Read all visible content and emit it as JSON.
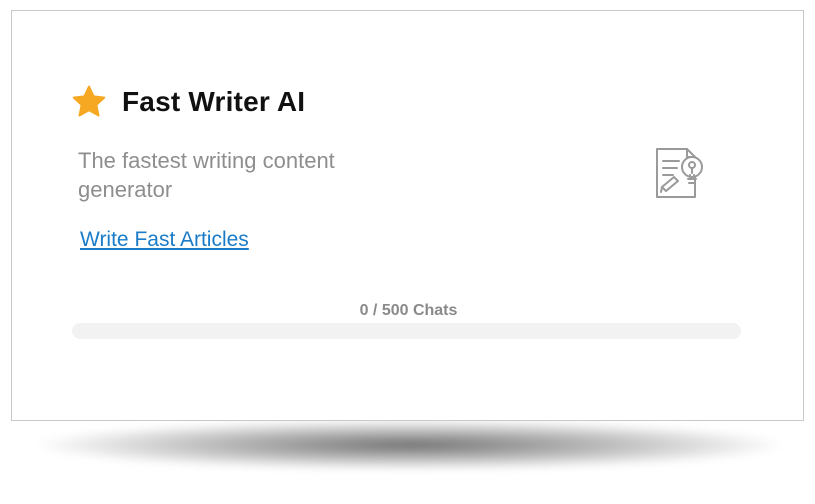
{
  "card": {
    "title": "Fast Writer AI",
    "description": "The fastest writing content generator",
    "link_label": "Write Fast Articles",
    "icons": {
      "title_icon": "star-icon",
      "illustration_icon": "document-lightbulb-icon"
    },
    "usage": {
      "label": "0 / 500 Chats",
      "used": 0,
      "limit": 500,
      "progress_fraction": 0
    }
  },
  "colors": {
    "star": "#f7a823",
    "link": "#1a7cc8",
    "muted_text": "#8e8e8e",
    "icon_gray": "#9a9a9a",
    "progress_track": "#f2f2f2"
  }
}
